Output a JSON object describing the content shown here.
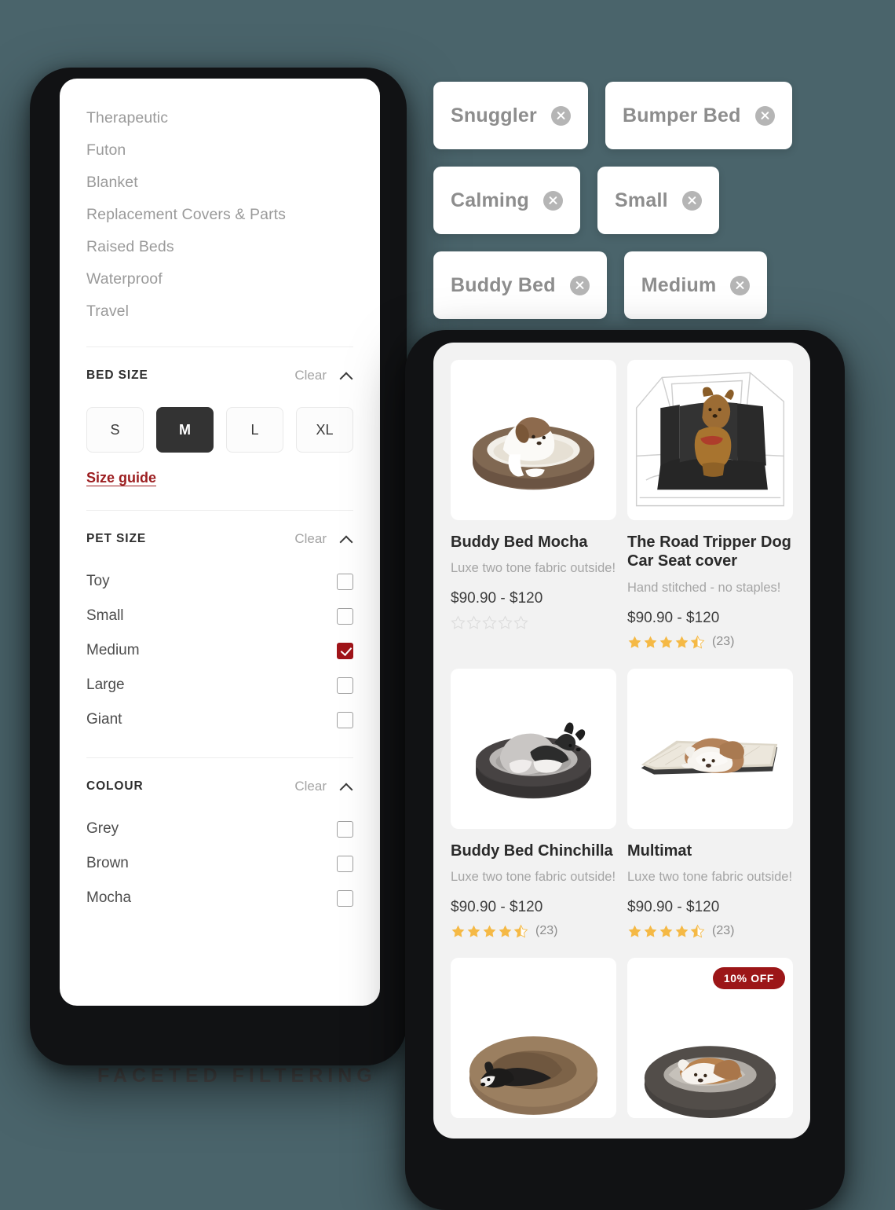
{
  "watermark": "FACETED FILTERING",
  "theme": {
    "background": "#4a646b",
    "accent_red": "#a01419",
    "badge_red": "#9c1618",
    "star_gold": "#F5B945",
    "selected_dark": "#333333"
  },
  "sidebar": {
    "categories": [
      {
        "label": "Therapeutic"
      },
      {
        "label": "Futon"
      },
      {
        "label": "Blanket"
      },
      {
        "label": "Replacement Covers & Parts"
      },
      {
        "label": "Raised Beds"
      },
      {
        "label": "Waterproof"
      },
      {
        "label": "Travel"
      }
    ],
    "bed_size": {
      "title": "BED SIZE",
      "clear_label": "Clear",
      "collapse_icon": "chevron-up-icon",
      "options": [
        {
          "label": "S",
          "selected": false
        },
        {
          "label": "M",
          "selected": true
        },
        {
          "label": "L",
          "selected": false
        },
        {
          "label": "XL",
          "selected": false
        }
      ],
      "size_guide_label": "Size guide"
    },
    "pet_size": {
      "title": "PET SIZE",
      "clear_label": "Clear",
      "collapse_icon": "chevron-up-icon",
      "options": [
        {
          "label": "Toy",
          "checked": false
        },
        {
          "label": "Small",
          "checked": false
        },
        {
          "label": "Medium",
          "checked": true
        },
        {
          "label": "Large",
          "checked": false
        },
        {
          "label": "Giant",
          "checked": false
        }
      ]
    },
    "colour": {
      "title": "COLOUR",
      "clear_label": "Clear",
      "collapse_icon": "chevron-up-icon",
      "options": [
        {
          "label": "Grey",
          "checked": false
        },
        {
          "label": "Brown",
          "checked": false
        },
        {
          "label": "Mocha",
          "checked": false
        }
      ]
    }
  },
  "active_filters": {
    "remove_icon": "close-circle-icon",
    "chips": [
      {
        "label": "Snuggler"
      },
      {
        "label": "Bumper Bed"
      },
      {
        "label": "Calming"
      },
      {
        "label": "Small"
      },
      {
        "label": "Buddy Bed"
      },
      {
        "label": "Medium"
      }
    ]
  },
  "products": [
    {
      "title": "Buddy Bed Mocha",
      "desc": "Luxe two tone fabric outside!",
      "price": "$90.90 - $120",
      "rating": 0,
      "review_count": "",
      "badge": "",
      "art": "bed-mocha"
    },
    {
      "title": "The Road Tripper Dog Car Seat cover",
      "desc": "Hand stitched - no staples!",
      "price": "$90.90 - $120",
      "rating": 4.5,
      "review_count": "(23)",
      "badge": "",
      "art": "car-seat"
    },
    {
      "title": "Buddy Bed Chinchilla",
      "desc": "Luxe two tone fabric outside!",
      "price": "$90.90 - $120",
      "rating": 4.5,
      "review_count": "(23)",
      "badge": "",
      "art": "bed-chinchilla"
    },
    {
      "title": "Multimat",
      "desc": "Luxe two tone fabric outside!",
      "price": "$90.90 - $120",
      "rating": 4.5,
      "review_count": "(23)",
      "badge": "",
      "art": "multimat"
    },
    {
      "title": "",
      "desc": "",
      "price": "",
      "rating": 0,
      "review_count": "",
      "badge": "",
      "art": "bed-donut-brown"
    },
    {
      "title": "",
      "desc": "",
      "price": "",
      "rating": 0,
      "review_count": "",
      "badge": "10% OFF",
      "art": "bed-grey-sleep"
    }
  ]
}
